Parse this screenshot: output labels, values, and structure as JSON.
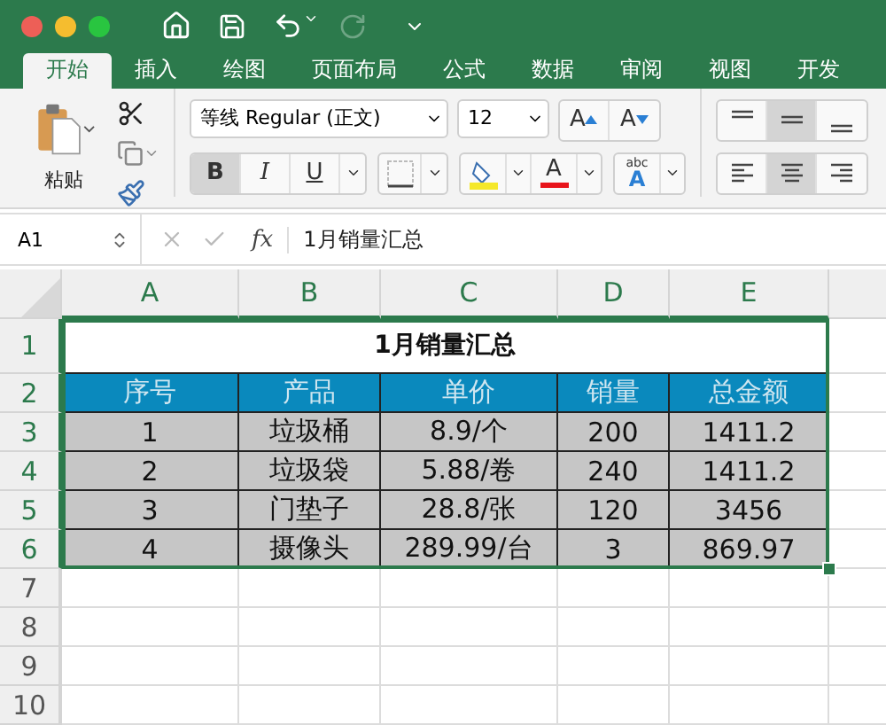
{
  "tabs": [
    {
      "label": "开始",
      "selected": true
    },
    {
      "label": "插入",
      "selected": false
    },
    {
      "label": "绘图",
      "selected": false
    },
    {
      "label": "页面布局",
      "selected": false
    },
    {
      "label": "公式",
      "selected": false
    },
    {
      "label": "数据",
      "selected": false
    },
    {
      "label": "审阅",
      "selected": false
    },
    {
      "label": "视图",
      "selected": false
    },
    {
      "label": "开发",
      "selected": false
    }
  ],
  "ribbon": {
    "paste_label": "粘贴",
    "font_name": "等线 Regular (正文)",
    "font_size": "12",
    "grow_font": "A",
    "shrink_font": "A",
    "font_color_letter": "A",
    "text_effects": {
      "small": "abc",
      "large": "A"
    },
    "format_buttons": [
      {
        "kind": "bold",
        "label": "B",
        "pressed": true
      },
      {
        "kind": "italic",
        "label": "I",
        "pressed": false
      },
      {
        "kind": "underline",
        "label": "U",
        "pressed": false
      }
    ],
    "vertical_align": [
      {
        "kind": "top",
        "pressed": false
      },
      {
        "kind": "middle",
        "pressed": true
      },
      {
        "kind": "bottom",
        "pressed": false
      }
    ],
    "horizontal_align": [
      {
        "kind": "left",
        "pressed": false
      },
      {
        "kind": "center",
        "pressed": true
      },
      {
        "kind": "right",
        "pressed": false
      }
    ]
  },
  "formula_bar": {
    "name_box": "A1",
    "fx": "fx",
    "content": "1月销量汇总"
  },
  "sheet": {
    "title": "1月销量汇总",
    "columns": [
      {
        "label": "A",
        "selected": true
      },
      {
        "label": "B",
        "selected": true
      },
      {
        "label": "C",
        "selected": true
      },
      {
        "label": "D",
        "selected": true
      },
      {
        "label": "E",
        "selected": true
      }
    ],
    "rows": [
      {
        "number": "1",
        "selected": true,
        "kind": "title"
      },
      {
        "number": "2",
        "selected": true,
        "kind": "header",
        "cells": [
          "序号",
          "产品",
          "单价",
          "销量",
          "总金额"
        ]
      },
      {
        "number": "3",
        "selected": true,
        "kind": "data",
        "cells": [
          "1",
          "垃圾桶",
          "8.9/个",
          "200",
          "1411.2"
        ]
      },
      {
        "number": "4",
        "selected": true,
        "kind": "data",
        "cells": [
          "2",
          "垃圾袋",
          "5.88/卷",
          "240",
          "1411.2"
        ]
      },
      {
        "number": "5",
        "selected": true,
        "kind": "data",
        "cells": [
          "3",
          "门垫子",
          "28.8/张",
          "120",
          "3456"
        ]
      },
      {
        "number": "6",
        "selected": true,
        "kind": "data",
        "cells": [
          "4",
          "摄像头",
          "289.99/台",
          "3",
          "869.97"
        ]
      },
      {
        "number": "7",
        "selected": false,
        "kind": "empty"
      },
      {
        "number": "8",
        "selected": false,
        "kind": "empty"
      },
      {
        "number": "9",
        "selected": false,
        "kind": "empty"
      },
      {
        "number": "10",
        "selected": false,
        "kind": "empty"
      }
    ]
  }
}
